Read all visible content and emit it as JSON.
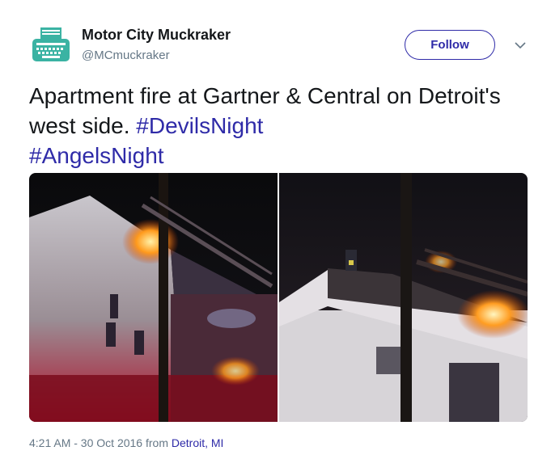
{
  "author": {
    "name": "Motor City Muckraker",
    "handle": "@MCmuckraker",
    "avatar_icon": "typewriter-icon"
  },
  "actions": {
    "follow_label": "Follow",
    "more_icon": "chevron-down-icon"
  },
  "tweet": {
    "text_plain": "Apartment fire at Gartner & Central on Detroit's west side.",
    "hashtags": [
      "#DevilsNight",
      "#AngelsNight"
    ]
  },
  "meta": {
    "time": "4:21 AM - 30 Oct 2016",
    "from_word": "from",
    "location": "Detroit, MI"
  },
  "colors": {
    "accent": "#2f2ba8",
    "secondary_text": "#657786",
    "avatar_teal": "#3bb3a3"
  }
}
